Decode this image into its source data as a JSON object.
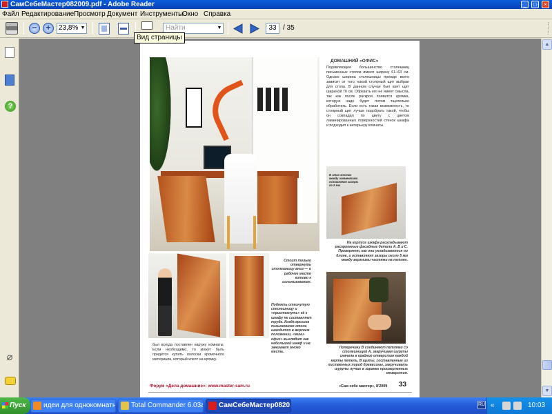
{
  "window": {
    "title": "СамСебеМастер082009.pdf - Adobe Reader",
    "controls": {
      "minimize": "_",
      "maximize": "□",
      "close": "×"
    }
  },
  "menu": [
    "Файл",
    "Редактирование",
    "Просмотр",
    "Документ",
    "Инструменты",
    "Окно",
    "Справка"
  ],
  "toolbar": {
    "zoom_value": "23,8%",
    "search_placeholder": "Найти",
    "current_page": "33",
    "total_pages": "/ 35",
    "tooltip": "Вид страницы"
  },
  "document": {
    "heading": "ДОМАШНИЙ «ОФИС»",
    "body_right": "Подавляющее большинство столешниц письменных столов имеют ширину 61–63 см. Однако ширина столешницы прежде всего зависит от того, какой стоярный щит выбран для стола. В данном случае был взят щит шириной 70 см. Обрезать его не имеет смысла, так как после раскроя появится кромка, которую надо будет потом тщательно обработать. Если есть такая возможность, то стоярный щит лучше подобрать такой, чтобы он совпадал по цвету с цветом ламинированных поверхностей стенок шкафа и подходил к интерьеру комнаты.",
    "photo_label_step1": "В этих местах между элементами оставляют зазоры по 5 мм",
    "caption_step1": "На корпусе шкафа раскладывают раскроенные фасадные детали А, В и С. Проверяют, как они укладываются по длине, и оставляют зазоры около 5 мм между верхними частями на петлях.",
    "caption_right_photo": "Стоит только отвернуть столешницу вниз — и рабочее место готово к использованию.",
    "caption_bottom_photo": "Поднять откинутую столешницу и «пристегнуть» её к шкафу не составляет труда. Когда крышка письменного стола находится в верхнем положении, «мини- офис» выглядит как небольшой шкаф и не занимает много места.",
    "body_bottom_left": "был всегда поставлен наружу комнаты. Если необходимо, то может быть придётся купить полоски кромочного материала, который клеят на кромку.",
    "caption_step2": "Поперечину В соединяют петлями со столешницей А, закручивая шурупы сначала в крайние отверстия каждой карты петель. В щиты, составленные из лиственных пород древесины, закручивать шурупы лучше в заранее просверленные отверстия.",
    "forum": "Форум «Дела домашние»: www.master-sam.ru",
    "issue": "«Сам себе мастер», 8'2009",
    "page_number": "33"
  },
  "taskbar": {
    "start": "Пуск",
    "tasks": [
      "идеи для однокомнатн...",
      "Total Commander 6.03a ...",
      "СамСебеМастер0820..."
    ],
    "lang": "RU",
    "chevron": "«",
    "clock": "10:03"
  },
  "colors": {
    "title_bar": "#0842b5",
    "doc_background": "#808080",
    "forum_red": "#b2122e",
    "wood": "#c66a2d"
  }
}
